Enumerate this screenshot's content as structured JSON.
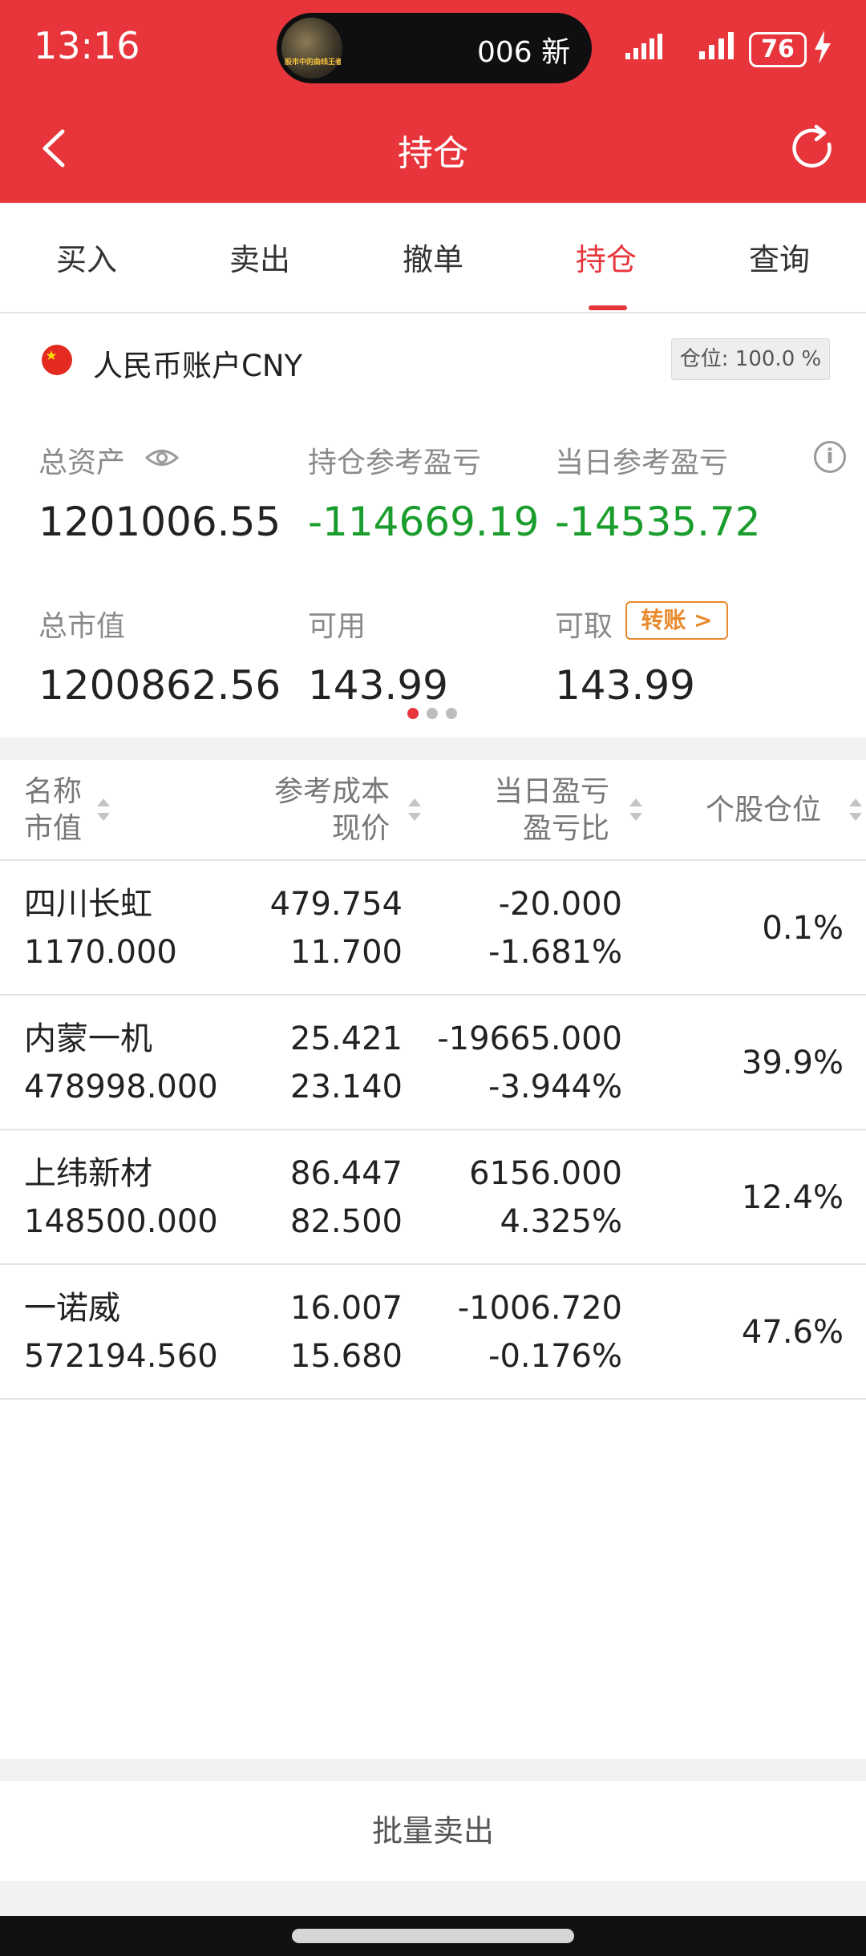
{
  "status_bar": {
    "time": "13:16",
    "island_text": "006 新",
    "island_thumb_text": "股市中的曲线王者",
    "battery": "76"
  },
  "header": {
    "title": "持仓"
  },
  "tabs": [
    "买入",
    "卖出",
    "撤单",
    "持仓",
    "查询"
  ],
  "active_tab": "持仓",
  "account": {
    "name": "人民币账户CNY",
    "position_badge": "仓位: 100.0 %"
  },
  "summary": {
    "total_assets_label": "总资产",
    "total_assets": "1201006.55",
    "holding_pl_label": "持仓参考盈亏",
    "holding_pl": "-114669.19",
    "daily_pl_label": "当日参考盈亏",
    "daily_pl": "-14535.72",
    "market_value_label": "总市值",
    "market_value": "1200862.56",
    "available_label": "可用",
    "available": "143.99",
    "withdrawable_label": "可取",
    "withdrawable": "143.99",
    "transfer_label": "转账 >"
  },
  "table": {
    "headers": {
      "name_top": "名称",
      "name_bottom": "市值",
      "cost_top": "参考成本",
      "cost_bottom": "现价",
      "pl_top": "当日盈亏",
      "pl_bottom": "盈亏比",
      "weight": "个股仓位"
    },
    "rows": [
      {
        "name": "四川长虹",
        "market_value": "1170.000",
        "cost": "479.754",
        "price": "11.700",
        "daily_pl": "-20.000",
        "pl_ratio": "-1.681%",
        "weight": "0.1%"
      },
      {
        "name": "内蒙一机",
        "market_value": "478998.000",
        "cost": "25.421",
        "price": "23.140",
        "daily_pl": "-19665.000",
        "pl_ratio": "-3.944%",
        "weight": "39.9%"
      },
      {
        "name": "上纬新材",
        "market_value": "148500.000",
        "cost": "86.447",
        "price": "82.500",
        "daily_pl": "6156.000",
        "pl_ratio": "4.325%",
        "weight": "12.4%"
      },
      {
        "name": "一诺威",
        "market_value": "572194.560",
        "cost": "16.007",
        "price": "15.680",
        "daily_pl": "-1006.720",
        "pl_ratio": "-0.176%",
        "weight": "47.6%"
      }
    ]
  },
  "footer": {
    "batch_sell": "批量卖出"
  },
  "colors": {
    "brand": "#e8353b",
    "loss": "#1a9d2c",
    "gain": "#e03636",
    "accent": "#e88a2c"
  }
}
